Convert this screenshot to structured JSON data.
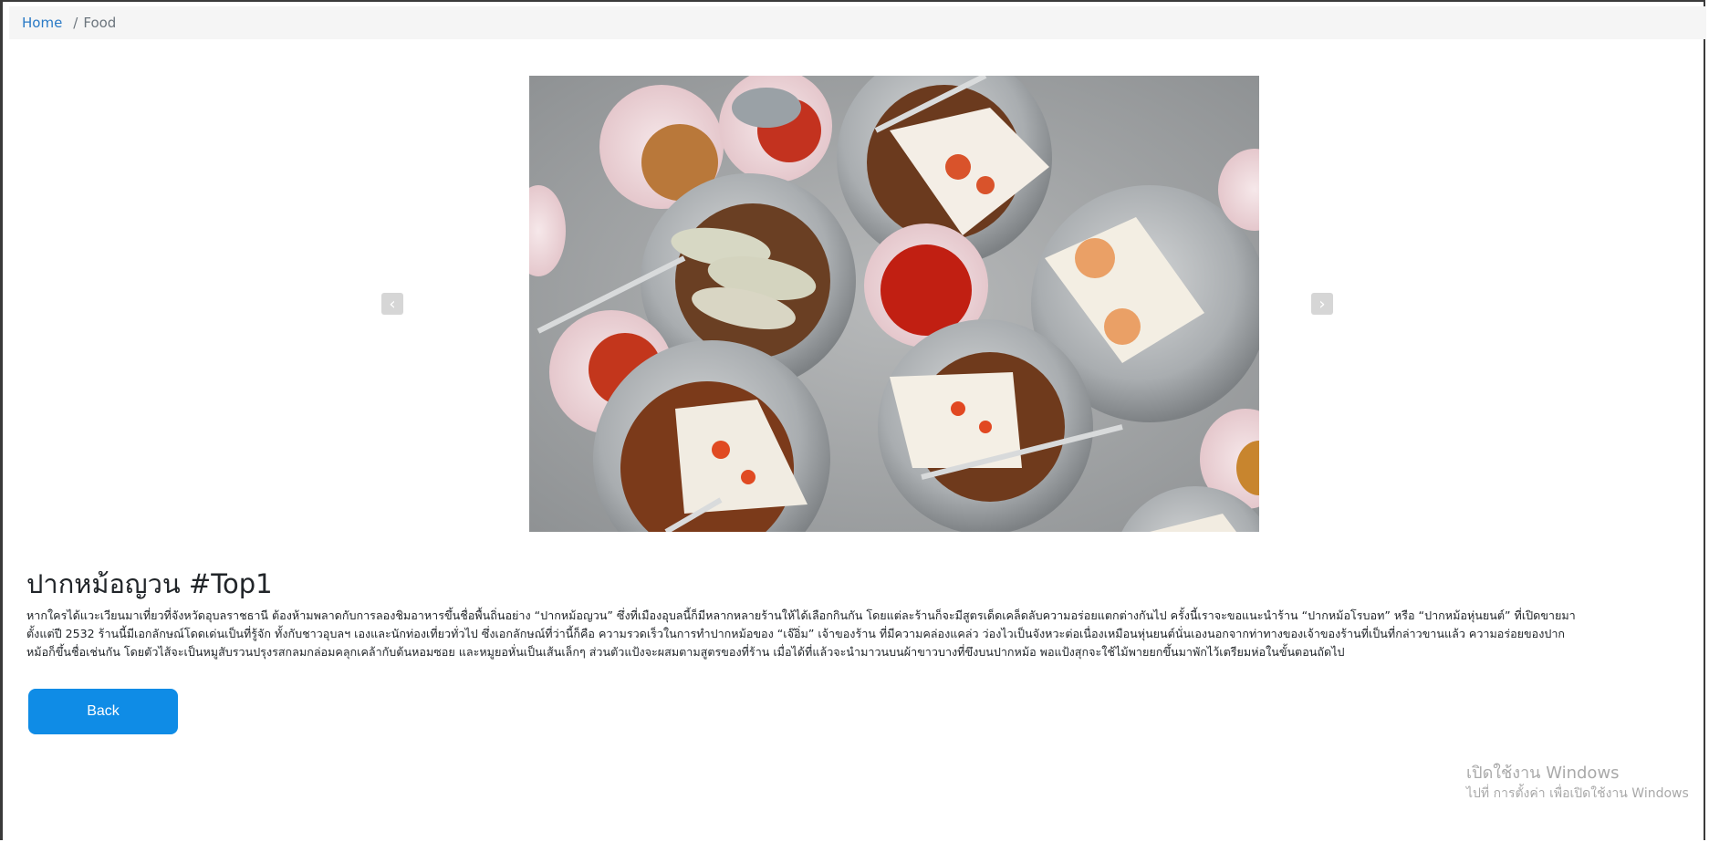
{
  "breadcrumb": {
    "home": "Home",
    "separator": "/",
    "current": "Food"
  },
  "carousel": {
    "image_alt": "ปากหม้อญวน",
    "prev_icon": "chevron-left-icon",
    "next_icon": "chevron-right-icon",
    "prev_glyph": "‹",
    "next_glyph": "›"
  },
  "article": {
    "title": "ปากหม้อญวน #Top1",
    "description": "หากใครได้แวะเวียนมาเที่ยวที่จังหวัดอุบลราชธานี ต้องห้ามพลาดกับการลองชิมอาหารขึ้นชื่อพื้นถิ่นอย่าง “ปากหม้อญวน” ซึ่งที่เมืองอุบลนี้ก็มีหลากหลายร้านให้ได้เลือกกินกัน โดยแต่ละร้านก็จะมีสูตรเด็ดเคล็ดลับความอร่อยแตกต่างกันไป ครั้งนี้เราจะขอแนะนำร้าน “ปากหม้อโรบอท” หรือ “ปากหม้อหุ่นยนต์” ที่เปิดขายมาตั้งแต่ปี 2532 ร้านนี้มีเอกลักษณ์โดดเด่นเป็นที่รู้จัก ทั้งกับชาวอุบลฯ เองและนักท่องเที่ยวทั่วไป ซึ่งเอกลักษณ์ที่ว่านี้ก็คือ ความรวดเร็วในการทำปากหม้อของ “เจ๊อิ่ม” เจ้าของร้าน ที่มีความคล่องแคล่ว ว่องไวเป็นจังหวะต่อเนื่องเหมือนหุ่นยนต์นั่นเองนอกจากท่าทางของเจ้าของร้านที่เป็นที่กล่าวขานแล้ว ความอร่อยของปากหม้อก็ขึ้นชื่อเช่นกัน โดยตัวไส้จะเป็นหมูสับรวนปรุงรสกลมกล่อมคลุกเคล้ากับต้นหอมซอย และหมูยอหั่นเป็นเส้นเล็กๆ ส่วนตัวแป้งจะผสมตามสูตรของที่ร้าน เมื่อได้ที่แล้วจะนำมาวนบนผ้าขาวบางที่ขึงบนปากหม้อ พอแป้งสุกจะใช้ไม้พายยกขึ้นมาพักไว้เตรียมห่อในขั้นตอนถัดไป"
  },
  "actions": {
    "back_label": "Back"
  },
  "watermark": {
    "line1": "เปิดใช้งาน Windows",
    "line2": "ไปที่ การตั้งค่า เพื่อเปิดใช้งาน Windows"
  },
  "colors": {
    "link": "#2a7ac6",
    "primary_button": "#0f8ce6",
    "breadcrumb_bg": "#f5f5f5"
  }
}
